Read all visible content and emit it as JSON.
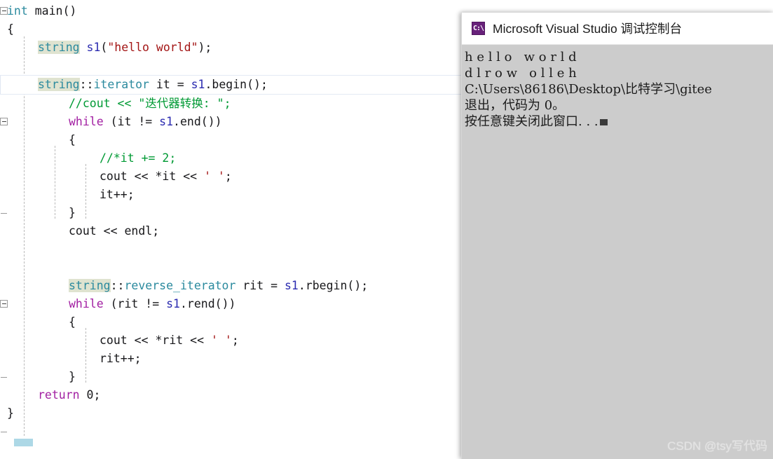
{
  "editor": {
    "name": "visual-studio-code-editor",
    "background": "#ffffff",
    "colors": {
      "keyword": "#a21fa2",
      "type": "#2b8a9e",
      "type_highlight_bg": "#dfe3d0",
      "string_literal": "#a31515",
      "comment": "#009a34",
      "variable": "#2b2bb0",
      "plain": "#17171a",
      "current_line_border": "#dfe6f2"
    },
    "lines": [
      {
        "n": 1,
        "fold": "open",
        "indent": 0,
        "tokens": [
          {
            "t": "int",
            "c": "type"
          },
          {
            "t": " ",
            "c": "punct"
          },
          {
            "t": "main",
            "c": "ident"
          },
          {
            "t": "()",
            "c": "punct"
          }
        ]
      },
      {
        "n": 2,
        "fold": "none",
        "indent": 0,
        "tokens": [
          {
            "t": "{",
            "c": "punct"
          }
        ]
      },
      {
        "n": 3,
        "fold": "none",
        "indent": 1,
        "tokens": [
          {
            "t": "string",
            "c": "type-hl"
          },
          {
            "t": " ",
            "c": "punct"
          },
          {
            "t": "s1",
            "c": "var"
          },
          {
            "t": "(",
            "c": "punct"
          },
          {
            "t": "\"hello world\"",
            "c": "str"
          },
          {
            "t": ");",
            "c": "punct"
          }
        ]
      },
      {
        "n": 4,
        "fold": "none",
        "indent": 1,
        "tokens": []
      },
      {
        "n": 5,
        "fold": "none",
        "indent": 1,
        "current": true,
        "tokens": [
          {
            "t": "string",
            "c": "type-hl"
          },
          {
            "t": "::",
            "c": "punct"
          },
          {
            "t": "iterator",
            "c": "type"
          },
          {
            "t": " ",
            "c": "punct"
          },
          {
            "t": "it",
            "c": "ident"
          },
          {
            "t": " = ",
            "c": "punct"
          },
          {
            "t": "s1",
            "c": "var"
          },
          {
            "t": ".",
            "c": "punct"
          },
          {
            "t": "begin",
            "c": "ident"
          },
          {
            "t": "();",
            "c": "punct"
          }
        ]
      },
      {
        "n": 6,
        "fold": "none",
        "indent": 2,
        "tokens": [
          {
            "t": "//cout << \"迭代器转换: \";",
            "c": "cmt"
          }
        ]
      },
      {
        "n": 7,
        "fold": "open",
        "indent": 2,
        "tokens": [
          {
            "t": "while",
            "c": "kw"
          },
          {
            "t": " (",
            "c": "punct"
          },
          {
            "t": "it",
            "c": "ident"
          },
          {
            "t": " != ",
            "c": "punct"
          },
          {
            "t": "s1",
            "c": "var"
          },
          {
            "t": ".",
            "c": "punct"
          },
          {
            "t": "end",
            "c": "ident"
          },
          {
            "t": "())",
            "c": "punct"
          }
        ]
      },
      {
        "n": 8,
        "fold": "none",
        "indent": 2,
        "tokens": [
          {
            "t": "{",
            "c": "punct"
          }
        ]
      },
      {
        "n": 9,
        "fold": "none",
        "indent": 3,
        "tokens": [
          {
            "t": "//*it += 2;",
            "c": "cmt"
          }
        ]
      },
      {
        "n": 10,
        "fold": "none",
        "indent": 3,
        "tokens": [
          {
            "t": "cout",
            "c": "ident"
          },
          {
            "t": " << ",
            "c": "punct"
          },
          {
            "t": "*it",
            "c": "ident"
          },
          {
            "t": " << ",
            "c": "punct"
          },
          {
            "t": "' '",
            "c": "str"
          },
          {
            "t": ";",
            "c": "punct"
          }
        ]
      },
      {
        "n": 11,
        "fold": "none",
        "indent": 3,
        "tokens": [
          {
            "t": "it++;",
            "c": "ident"
          }
        ]
      },
      {
        "n": 12,
        "fold": "end",
        "indent": 2,
        "tokens": [
          {
            "t": "}",
            "c": "punct"
          }
        ]
      },
      {
        "n": 13,
        "fold": "none",
        "indent": 2,
        "tokens": [
          {
            "t": "cout",
            "c": "ident"
          },
          {
            "t": " << ",
            "c": "punct"
          },
          {
            "t": "endl",
            "c": "ident"
          },
          {
            "t": ";",
            "c": "punct"
          }
        ]
      },
      {
        "n": 14,
        "fold": "none",
        "indent": 1,
        "tokens": []
      },
      {
        "n": 15,
        "fold": "none",
        "indent": 1,
        "tokens": []
      },
      {
        "n": 16,
        "fold": "none",
        "indent": 2,
        "tokens": [
          {
            "t": "string",
            "c": "type-hl"
          },
          {
            "t": "::",
            "c": "punct"
          },
          {
            "t": "reverse_iterator",
            "c": "type"
          },
          {
            "t": " ",
            "c": "punct"
          },
          {
            "t": "rit",
            "c": "ident"
          },
          {
            "t": " = ",
            "c": "punct"
          },
          {
            "t": "s1",
            "c": "var"
          },
          {
            "t": ".",
            "c": "punct"
          },
          {
            "t": "rbegin",
            "c": "ident"
          },
          {
            "t": "();",
            "c": "punct"
          }
        ]
      },
      {
        "n": 17,
        "fold": "open",
        "indent": 2,
        "tokens": [
          {
            "t": "while",
            "c": "kw"
          },
          {
            "t": " (",
            "c": "punct"
          },
          {
            "t": "rit",
            "c": "ident"
          },
          {
            "t": " != ",
            "c": "punct"
          },
          {
            "t": "s1",
            "c": "var"
          },
          {
            "t": ".",
            "c": "punct"
          },
          {
            "t": "rend",
            "c": "ident"
          },
          {
            "t": "())",
            "c": "punct"
          }
        ]
      },
      {
        "n": 18,
        "fold": "none",
        "indent": 2,
        "tokens": [
          {
            "t": "{",
            "c": "punct"
          }
        ]
      },
      {
        "n": 19,
        "fold": "none",
        "indent": 3,
        "tokens": [
          {
            "t": "cout",
            "c": "ident"
          },
          {
            "t": " << ",
            "c": "punct"
          },
          {
            "t": "*rit",
            "c": "ident"
          },
          {
            "t": " << ",
            "c": "punct"
          },
          {
            "t": "' '",
            "c": "str"
          },
          {
            "t": ";",
            "c": "punct"
          }
        ]
      },
      {
        "n": 20,
        "fold": "none",
        "indent": 3,
        "tokens": [
          {
            "t": "rit++;",
            "c": "ident"
          }
        ]
      },
      {
        "n": 21,
        "fold": "end",
        "indent": 2,
        "tokens": [
          {
            "t": "}",
            "c": "punct"
          }
        ]
      },
      {
        "n": 22,
        "fold": "none",
        "indent": 1,
        "tokens": [
          {
            "t": "return",
            "c": "kw"
          },
          {
            "t": " ",
            "c": "punct"
          },
          {
            "t": "0",
            "c": "num"
          },
          {
            "t": ";",
            "c": "punct"
          }
        ]
      },
      {
        "n": 23,
        "fold": "none",
        "indent": 0,
        "tokens": [
          {
            "t": "}",
            "c": "punct"
          }
        ]
      },
      {
        "n": 24,
        "fold": "end",
        "indent": 0,
        "tokens": []
      }
    ]
  },
  "console": {
    "name": "microsoft-visual-studio-debug-console",
    "icon": "cmd-prompt-icon",
    "icon_glyph": "C:\\",
    "title": "Microsoft Visual Studio 调试控制台",
    "background": "#cccccc",
    "titlebar_background": "#ffffff",
    "lines": [
      "h e l l o   w o r l d ",
      "d l r o w   o l l e h ",
      "C:\\Users\\86186\\Desktop\\比特学习\\gitee",
      "退出，代码为 0。",
      "按任意键关闭此窗口. . ."
    ]
  },
  "watermark": {
    "text": "CSDN @tsy写代码",
    "color": "#e2e2e2"
  }
}
